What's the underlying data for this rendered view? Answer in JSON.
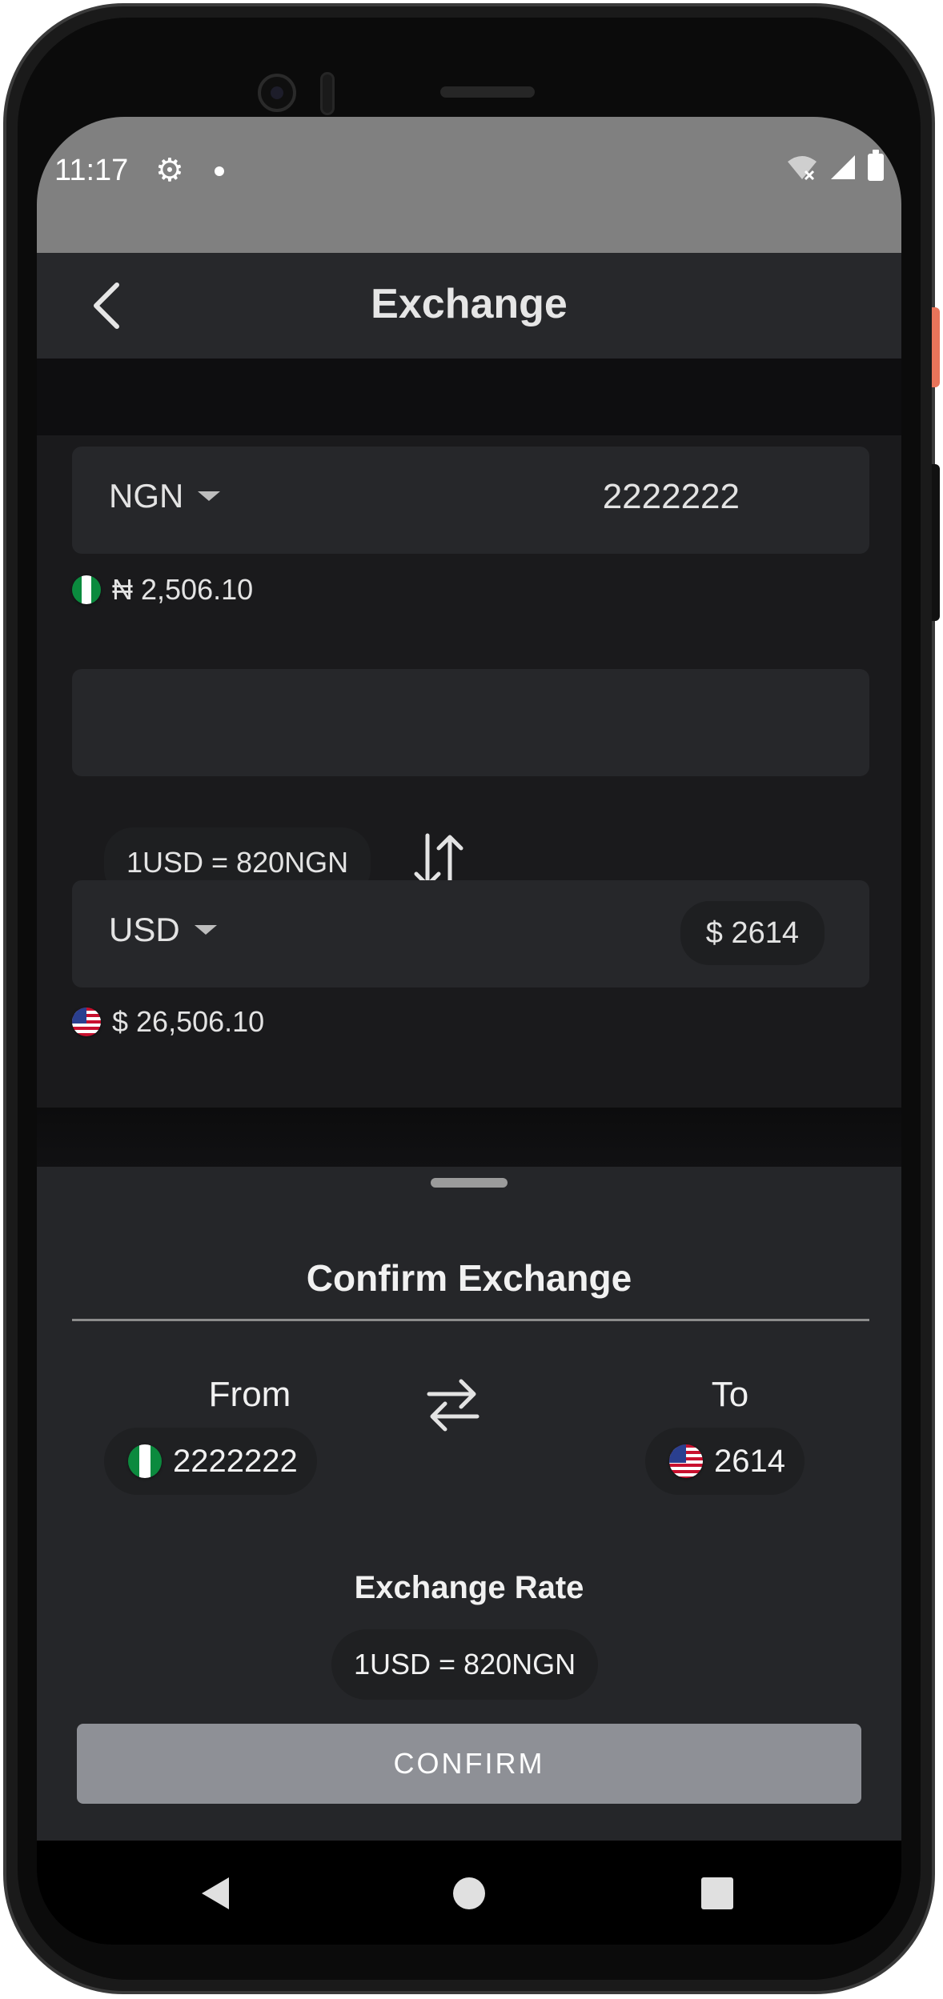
{
  "status_bar": {
    "time": "11:17",
    "icons": [
      "gear-icon",
      "notification-dot-icon",
      "wifi-off-icon",
      "signal-icon",
      "battery-icon"
    ]
  },
  "app_bar": {
    "title": "Exchange",
    "back_icon": "chevron-left-icon"
  },
  "exchange_form": {
    "from": {
      "currency": "NGN",
      "amount": "2222222",
      "flag": "nigeria-flag",
      "balance": "₦ 2,506.10"
    },
    "rate": "1USD = 820NGN",
    "swap_icon": "swap-vertical-arrows-icon",
    "to": {
      "currency": "USD",
      "amount": "$ 2614",
      "flag": "usa-flag",
      "balance": "$ 26,506.10"
    }
  },
  "confirm_sheet": {
    "title": "Confirm Exchange",
    "from_label": "From",
    "from_value": "2222222",
    "to_label": "To",
    "to_value": "2614",
    "swap_icon": "swap-horizontal-arrows-icon",
    "rate_title": "Exchange Rate",
    "rate_value": "1USD = 820NGN",
    "confirm_label": "CONFIRM"
  },
  "colors": {
    "background": "#1a1a1c",
    "card": "#26272a",
    "sheet": "#252629",
    "button_disabled": "#8e9096",
    "status_bar": "#808080",
    "accent_side_button": "#e8745a"
  }
}
